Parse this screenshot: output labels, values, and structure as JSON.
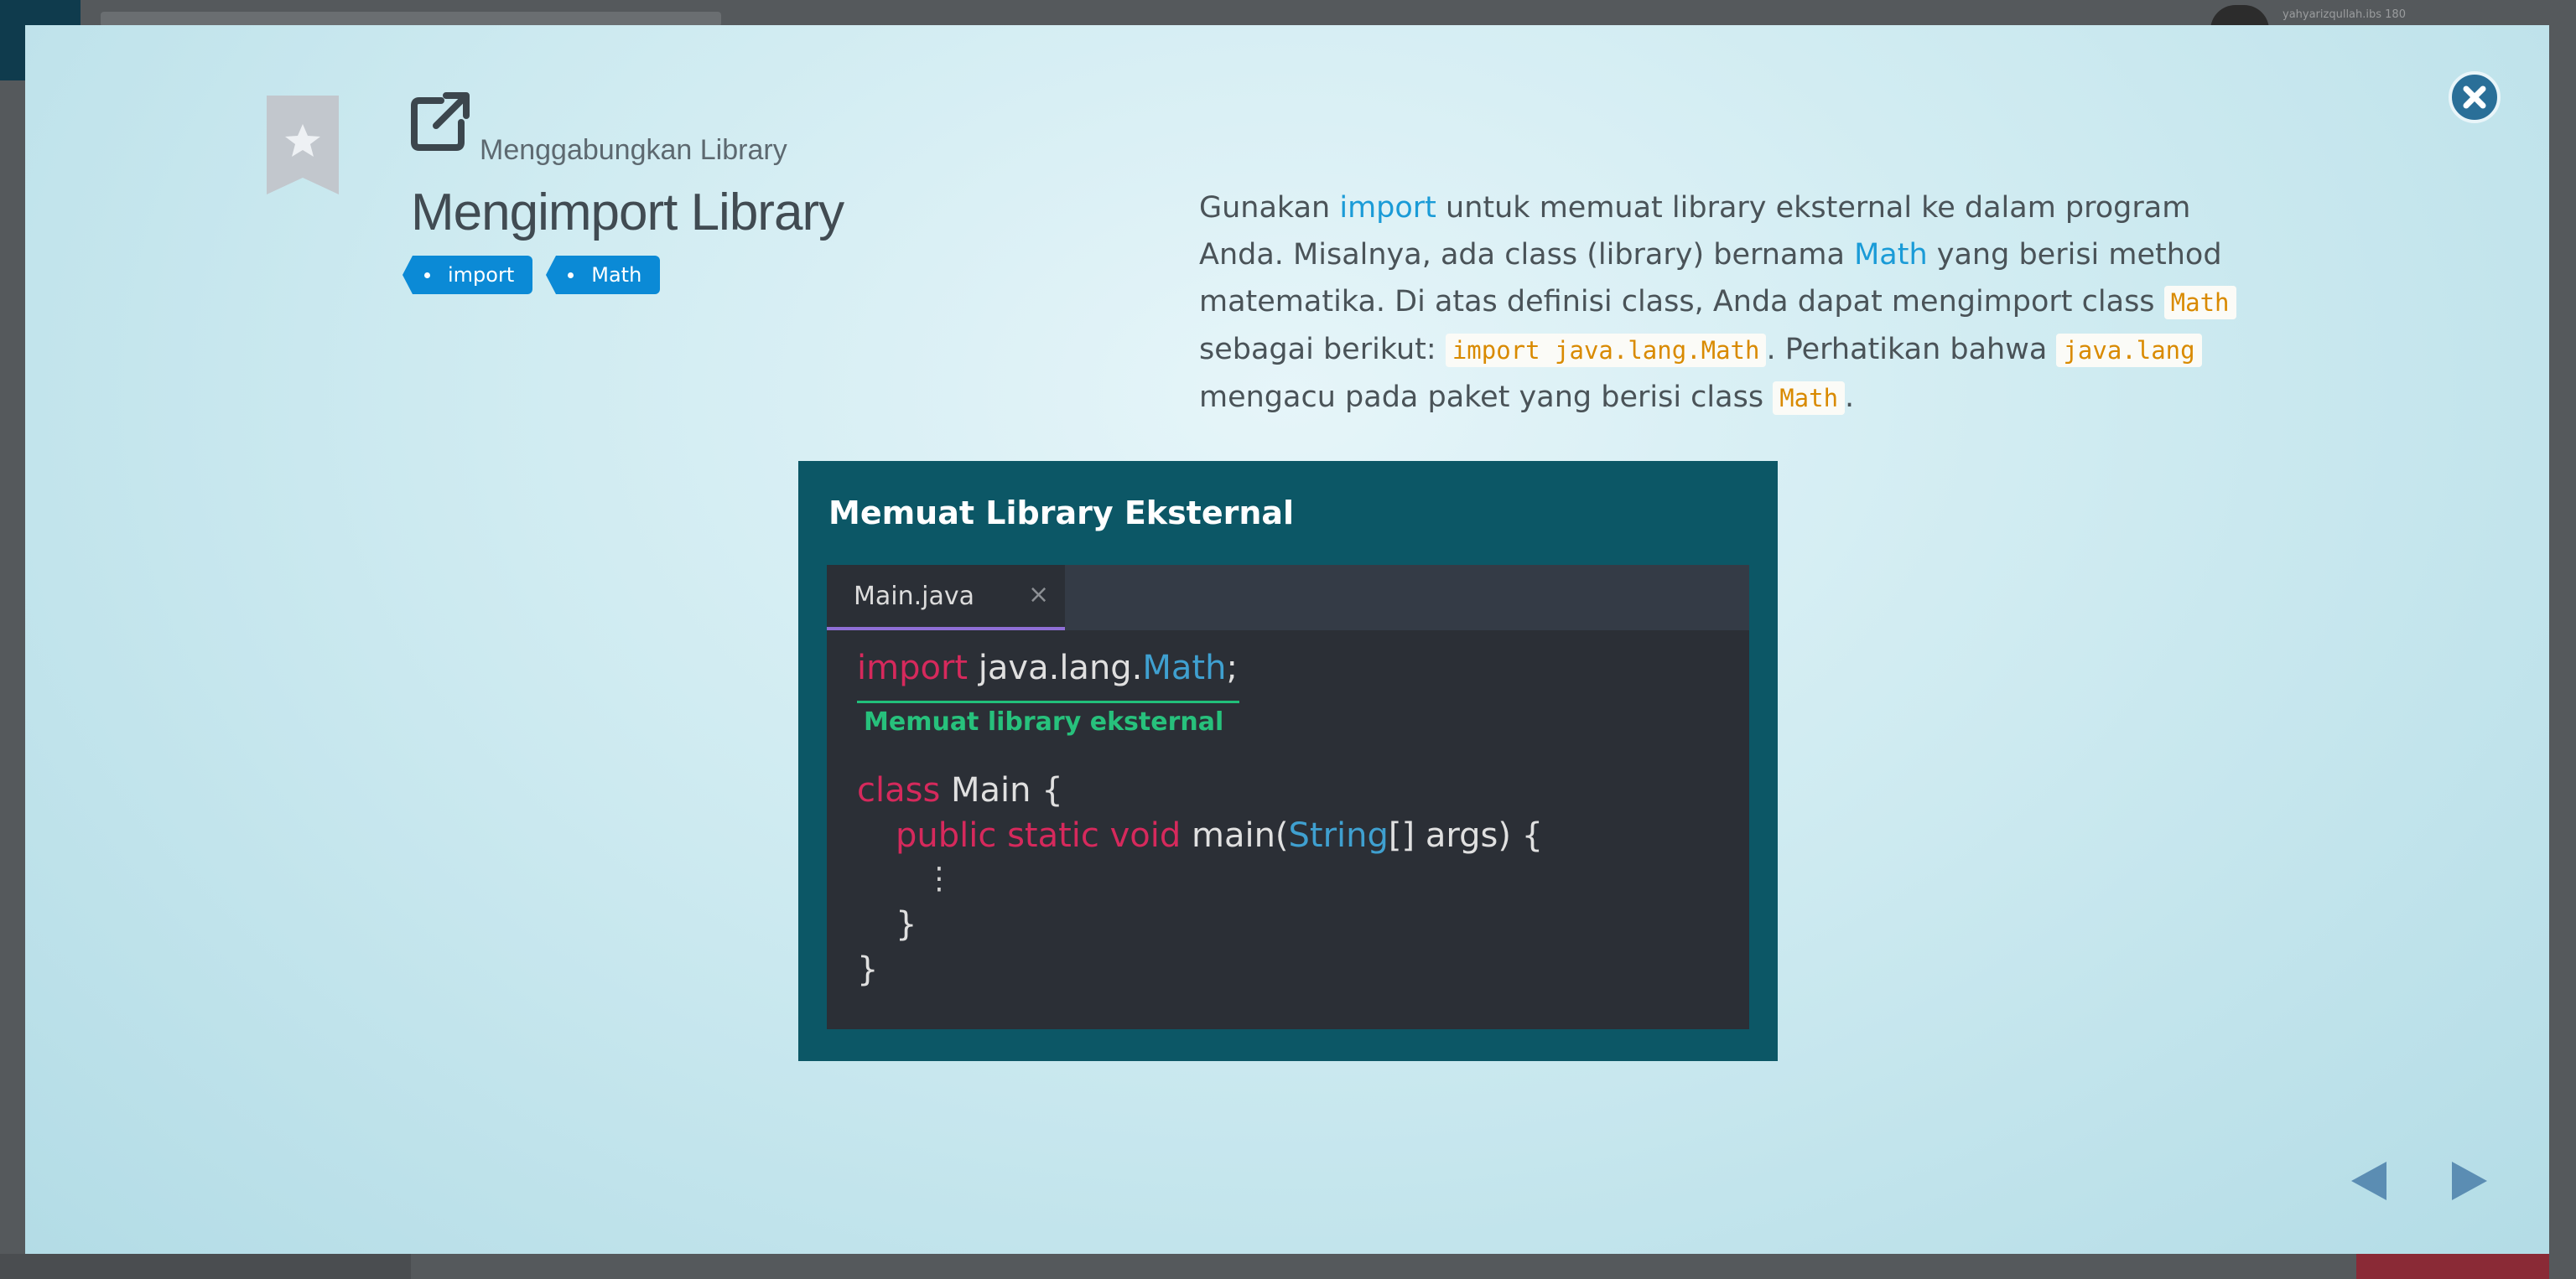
{
  "backdrop": {
    "username": "yahyarizqullah.ibs 180"
  },
  "modal": {
    "breadcrumb": "Menggabungkan Library",
    "title": "Mengimport Library",
    "tags": [
      "import",
      "Math"
    ],
    "description": {
      "s1": "Gunakan ",
      "kw1": "import",
      "s2": " untuk memuat library eksternal ke dalam program Anda. Misalnya, ada class (library) bernama ",
      "kw2": "Math",
      "s3": " yang berisi method matematika. Di atas definisi class, Anda dapat mengimport class ",
      "c1": "Math",
      "s4": " sebagai berikut: ",
      "c2": "import java.lang.Math",
      "s5": ". Perhatikan bahwa ",
      "c3": "java.lang",
      "s6": " mengacu pada paket yang berisi class ",
      "c4": "Math",
      "s7": "."
    },
    "illustration": {
      "title": "Memuat Library Eksternal",
      "tab_name": "Main.java",
      "tab_close": "×",
      "annotation": "Memuat library eksternal",
      "code": {
        "l1_kw": "import",
        "l1_pkg": " java.lang.",
        "l1_cls": "Math",
        "l1_end": ";",
        "l2_kw": "class",
        "l2_rest": " Main {",
        "l3_kw": "public static void",
        "l3_mid": " main(",
        "l3_type": "String",
        "l3_end": "[] args) {",
        "l4": "⋮",
        "l5": "}",
        "l6": "}"
      }
    }
  },
  "colors": {
    "accent": "#0b8ad6",
    "keyword_link": "#1a9bd7",
    "inline_code": "#d98a00",
    "nav_arrow": "#5b8db3",
    "close_button": "#2a6f98"
  }
}
